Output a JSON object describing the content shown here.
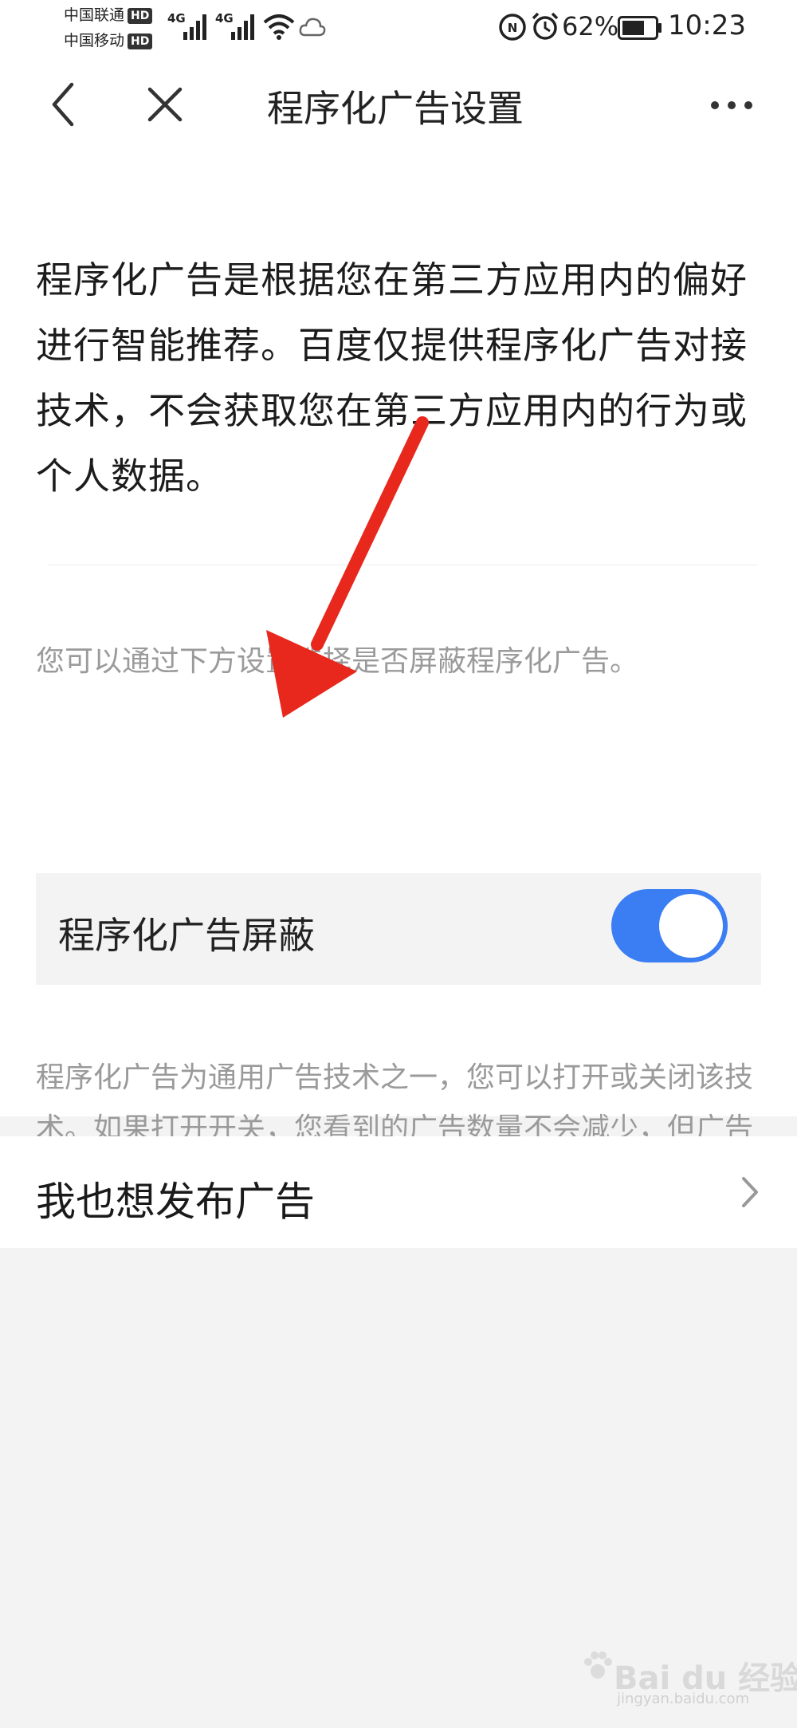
{
  "status_bar": {
    "carrier_1": "中国联通",
    "carrier_2": "中国移动",
    "hd_badge": "HD",
    "network_1": "4G",
    "network_2": "4G",
    "battery_percent": "62%",
    "time": "10:23",
    "icons": [
      "signal-icon",
      "wifi-icon",
      "cloud-icon",
      "nfc-icon",
      "alarm-icon",
      "battery-icon"
    ]
  },
  "nav": {
    "title": "程序化广告设置",
    "icons": [
      "back-icon",
      "close-icon",
      "more-icon"
    ]
  },
  "intro_text": "程序化广告是根据您在第三方应用内的偏好进行智能推荐。百度仅提供程序化广告对接技术，不会获取您在第三方应用内的行为或个人数据。",
  "hint_text": "您可以通过下方设置选择是否屏蔽程序化广告。",
  "toggle": {
    "label": "程序化广告屏蔽",
    "state": "on",
    "color": "#3b7ef3"
  },
  "description": "程序化广告为通用广告技术之一，您可以打开或关闭该技术。如果打开开关，您看到的广告数量不会减少，但广告的精准程度将会降低。",
  "link": {
    "label": "我也想发布广告",
    "icon": "chevron-right-icon"
  },
  "watermark": {
    "brand": "Bai du 经验",
    "url": "jingyan.baidu.com"
  },
  "annotation": {
    "arrow_color": "#e8281c"
  }
}
